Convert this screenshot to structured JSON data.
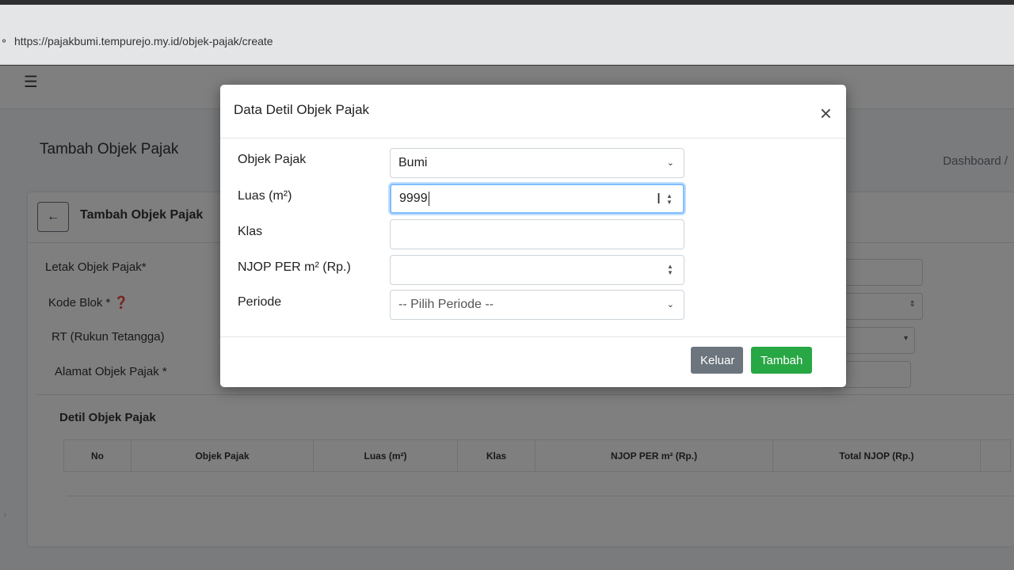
{
  "browser": {
    "url": "https://pajakbumi.tempurejo.my.id/objek-pajak/create"
  },
  "background": {
    "page_header": "Tambah Objek Pajak",
    "breadcrumb": "Dashboard /",
    "card_title": "Tambah Objek Pajak",
    "labels": {
      "letak": "Letak Objek Pajak*",
      "kode_blok": "Kode Blok *",
      "rt": "RT (Rukun Tetangga)",
      "alamat": "Alamat Objek Pajak *"
    },
    "section_title": "Detil Objek Pajak",
    "table_headers": [
      "No",
      "Objek Pajak",
      "Luas (m²)",
      "Klas",
      "NJOP PER m² (Rp.)",
      "Total NJOP (Rp.)",
      ""
    ]
  },
  "modal": {
    "title": "Data Detil Objek Pajak",
    "close_symbol": "×",
    "fields": {
      "objek_pajak": {
        "label": "Objek Pajak",
        "value": "Bumi"
      },
      "luas": {
        "label": "Luas (m²)",
        "value": "9999"
      },
      "klas": {
        "label": "Klas",
        "value": ""
      },
      "njop": {
        "label": "NJOP PER m² (Rp.)",
        "value": ""
      },
      "periode": {
        "label": "Periode",
        "placeholder": "-- Pilih Periode --"
      }
    },
    "buttons": {
      "keluar": "Keluar",
      "tambah": "Tambah"
    }
  },
  "colors": {
    "btn_secondary": "#6c757d",
    "btn_success": "#28a745",
    "focus_border": "#80bdff"
  }
}
